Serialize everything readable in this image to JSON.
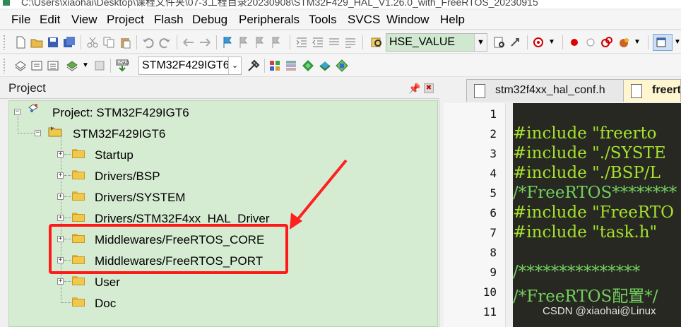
{
  "titlebar": {
    "path": "C:\\Users\\xiaohai\\Desktop\\课程文件夹\\07-3工程目录20230908\\STM32F429_HAL_V1.26.0_with_FreeRTOS_20230915"
  },
  "menu": [
    "File",
    "Edit",
    "View",
    "Project",
    "Flash",
    "Debug",
    "Peripherals",
    "Tools",
    "SVCS",
    "Window",
    "Help"
  ],
  "toolbar1": {
    "search_value": "HSE_VALUE"
  },
  "toolbar2": {
    "target_value": "STM32F429IGT6"
  },
  "project_panel": {
    "title": "Project",
    "root": "Project: STM32F429IGT6",
    "target": "STM32F429IGT6",
    "groups": [
      "Startup",
      "Drivers/BSP",
      "Drivers/SYSTEM",
      "Drivers/STM32F4xx_HAL_Driver",
      "Middlewares/FreeRTOS_CORE",
      "Middlewares/FreeRTOS_PORT",
      "User",
      "Doc"
    ]
  },
  "editor": {
    "tabs": [
      "stm32f4xx_hal_conf.h",
      "freert"
    ],
    "line_numbers": [
      "1",
      "2",
      "3",
      "4",
      "5",
      "6",
      "7",
      "8",
      "9",
      "10",
      "11"
    ],
    "lines": [
      {
        "text": "",
        "color": "#a6e22e"
      },
      {
        "text": "#include \"freerto",
        "color": "#a6e22e"
      },
      {
        "text": "#include \"./SYSTE",
        "color": "#a6e22e"
      },
      {
        "text": "#include \"./BSP/L",
        "color": "#a6e22e"
      },
      {
        "text": "/*FreeRTOS********",
        "color": "#75d05e"
      },
      {
        "text": "#include \"FreeRTO",
        "color": "#a6e22e"
      },
      {
        "text": "#include \"task.h\"",
        "color": "#a6e22e"
      },
      {
        "text": "",
        "color": "#a6e22e"
      },
      {
        "text": "/***************",
        "color": "#75d05e"
      },
      {
        "text": "/*FreeRTOS配置*/",
        "color": "#75d05e"
      },
      {
        "text": "",
        "color": "#a6e22e"
      }
    ]
  },
  "watermark": "CSDN @xiaohai@Linux"
}
